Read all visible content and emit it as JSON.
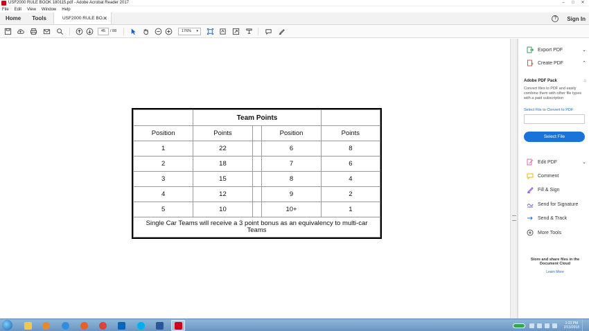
{
  "window": {
    "title": "USF2000 RULE BOOK 180115.pdf - Adobe Acrobat Reader 2017",
    "controls": [
      "–",
      "□",
      "✕"
    ]
  },
  "menu": [
    "File",
    "Edit",
    "View",
    "Window",
    "Help"
  ],
  "tabs": {
    "home": "Home",
    "tools": "Tools",
    "document": "USF2000 RULE BO...",
    "close": "✕",
    "help": "?",
    "sign_in": "Sign In"
  },
  "toolbar": {
    "page_current": "45",
    "page_total": "/ 88",
    "zoom": "176%",
    "zoom_caret": "▾"
  },
  "table": {
    "title": "Team Points",
    "headers": [
      "Position",
      "Points",
      "Position",
      "Points"
    ],
    "rows": [
      [
        "1",
        "22",
        "6",
        "8"
      ],
      [
        "2",
        "18",
        "7",
        "6"
      ],
      [
        "3",
        "15",
        "8",
        "4"
      ],
      [
        "4",
        "12",
        "9",
        "2"
      ],
      [
        "5",
        "10",
        "10+",
        "1"
      ]
    ],
    "note": "Single Car Teams will receive a 3 point bonus as an equivalency to multi-car Teams"
  },
  "right_panel": {
    "tools": [
      {
        "label": "Export PDF",
        "icon": "export-pdf-icon",
        "color": "#3a9d5d",
        "chevron": "⌄"
      },
      {
        "label": "Create PDF",
        "icon": "create-pdf-icon",
        "color": "#d9534f",
        "chevron": "⌃"
      },
      {
        "label": "Edit PDF",
        "icon": "edit-pdf-icon",
        "color": "#e06aa6",
        "chevron": "⌄"
      },
      {
        "label": "Comment",
        "icon": "comment-icon",
        "color": "#f0b400",
        "chevron": ""
      },
      {
        "label": "Fill & Sign",
        "icon": "fill-sign-icon",
        "color": "#8a5bd0",
        "chevron": ""
      },
      {
        "label": "Send for Signature",
        "icon": "send-signature-icon",
        "color": "#7a5bd0",
        "chevron": ""
      },
      {
        "label": "Send & Track",
        "icon": "send-track-icon",
        "color": "#1a73d9",
        "chevron": ""
      },
      {
        "label": "More Tools",
        "icon": "more-tools-icon",
        "color": "#555555",
        "chevron": ""
      }
    ],
    "pack": {
      "title": "Adobe PDF Pack",
      "description": "Convert files to PDF and easily combine them with other file types with a paid subscription",
      "link": "Select File to Convert to PDF",
      "button": "Select File"
    },
    "store": "Store and share files in the Document Cloud",
    "learn_more": "Learn More"
  },
  "taskbar": {
    "clock_time": "1:23 PM",
    "clock_date": "2/13/2018",
    "accent": "#6b95c2"
  }
}
